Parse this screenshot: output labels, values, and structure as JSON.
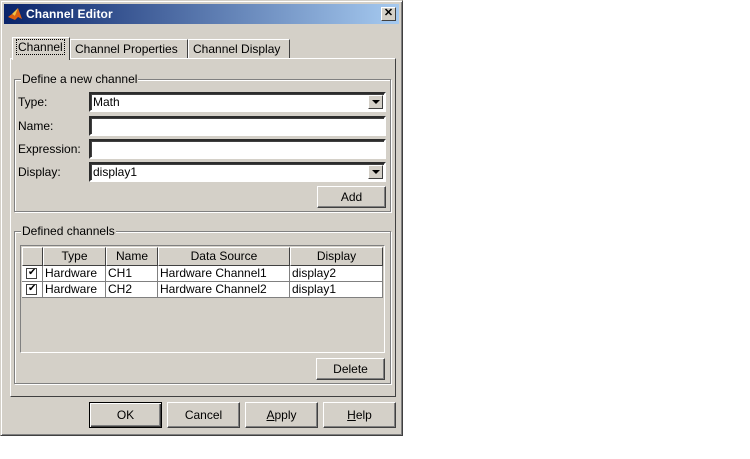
{
  "window": {
    "title": "Channel Editor",
    "close_glyph": "✕"
  },
  "tabs": [
    {
      "label": "Channel"
    },
    {
      "label": "Channel Properties"
    },
    {
      "label": "Channel Display"
    }
  ],
  "define": {
    "group_title": "Define a new channel",
    "type_label": "Type:",
    "type_value": "Math",
    "name_label": "Name:",
    "name_value": "",
    "expression_label": "Expression:",
    "expression_value": "",
    "display_label": "Display:",
    "display_value": "display1",
    "add_label": "Add"
  },
  "defined": {
    "group_title": "Defined channels",
    "columns": [
      "",
      "Type",
      "Name",
      "Data Source",
      "Display"
    ],
    "rows": [
      {
        "checked": true,
        "type": "Hardware",
        "name": "CH1",
        "source": "Hardware Channel1",
        "display": "display2"
      },
      {
        "checked": true,
        "type": "Hardware",
        "name": "CH2",
        "source": "Hardware Channel2",
        "display": "display1"
      }
    ],
    "delete_label": "Delete"
  },
  "footer": {
    "ok_label": "OK",
    "cancel_label": "Cancel",
    "apply_first": "A",
    "apply_rest": "pply",
    "help_first": "H",
    "help_rest": "elp"
  },
  "colors": {
    "titlebar_start": "#0a246a",
    "titlebar_end": "#a6caf0",
    "face": "#d4d0c8"
  }
}
